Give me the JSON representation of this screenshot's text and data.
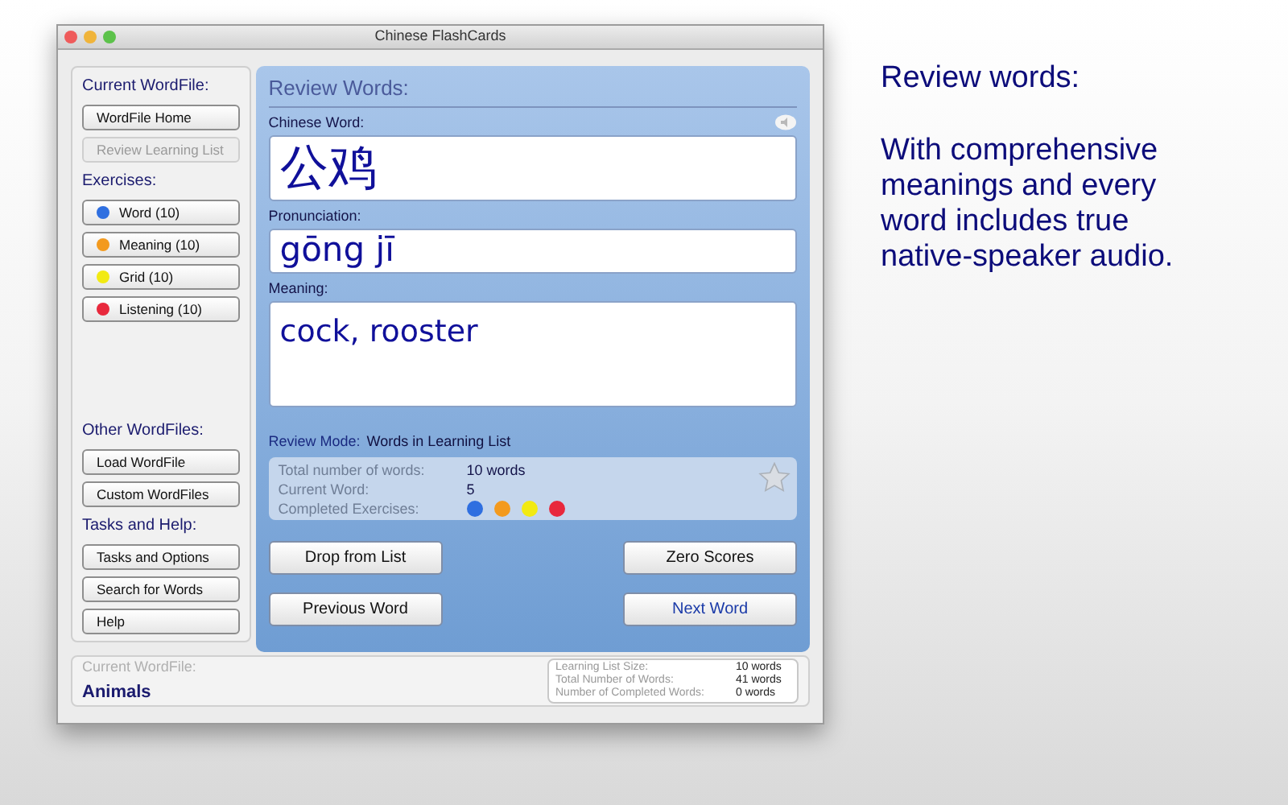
{
  "window": {
    "title": "Chinese FlashCards"
  },
  "sidebar": {
    "top": [
      {
        "heading": "Current WordFile:",
        "buttons": [
          {
            "label": "WordFile Home",
            "disabled": false
          },
          {
            "label": "Review Learning List",
            "disabled": true
          }
        ]
      },
      {
        "heading": "Exercises:",
        "buttons": [
          {
            "label": "Word (10)",
            "color": "#2f6fe0",
            "disabled": false
          },
          {
            "label": "Meaning (10)",
            "color": "#f39a1e",
            "disabled": false
          },
          {
            "label": "Grid (10)",
            "color": "#f2ea12",
            "disabled": false
          },
          {
            "label": "Listening (10)",
            "color": "#e8283c",
            "disabled": false
          }
        ]
      }
    ],
    "bottom": [
      {
        "heading": "Other WordFiles:",
        "buttons": [
          {
            "label": "Load WordFile",
            "disabled": false
          },
          {
            "label": "Custom WordFiles",
            "disabled": false
          }
        ]
      },
      {
        "heading": "Tasks and Help:",
        "buttons": [
          {
            "label": "Tasks and Options",
            "disabled": false
          },
          {
            "label": "Search for Words",
            "disabled": false
          },
          {
            "label": "Help",
            "disabled": false
          }
        ]
      }
    ]
  },
  "review": {
    "title": "Review Words:",
    "fields": [
      {
        "kind": "chinese",
        "label": "Chinese Word:",
        "value": "公鸡"
      },
      {
        "kind": "pinyin",
        "label": "Pronunciation:",
        "value": "gōng jī"
      },
      {
        "kind": "meaning",
        "label": "Meaning:",
        "value": "cock, rooster"
      }
    ],
    "mode_label": "Review Mode:",
    "mode_value": "Words in Learning List",
    "stats": [
      {
        "label": "Total number of words:",
        "value": "10 words"
      },
      {
        "label": "Current Word:",
        "value": "5"
      }
    ],
    "completed": {
      "label": "Completed Exercises:",
      "dots": [
        {
          "color": "#2f6fe0"
        },
        {
          "color": "#f39a1e"
        },
        {
          "color": "#f2ea12"
        },
        {
          "color": "#e8283c"
        }
      ]
    },
    "buttons": [
      {
        "label": "Drop from List",
        "default": false
      },
      {
        "label": "Zero Scores",
        "default": false
      },
      {
        "label": "Previous Word",
        "default": false
      },
      {
        "label": "Next Word",
        "default": true
      }
    ]
  },
  "footer": {
    "label": "Current WordFile:",
    "value": "Animals",
    "stats": [
      {
        "label": "Learning List Size:",
        "value": "10 words"
      },
      {
        "label": "Total Number of Words:",
        "value": "41 words"
      },
      {
        "label": "Number of Completed Words:",
        "value": "0 words"
      }
    ]
  },
  "caption": {
    "heading": "Review words:",
    "body": "With comprehensive meanings and every word includes true native-speaker audio."
  }
}
